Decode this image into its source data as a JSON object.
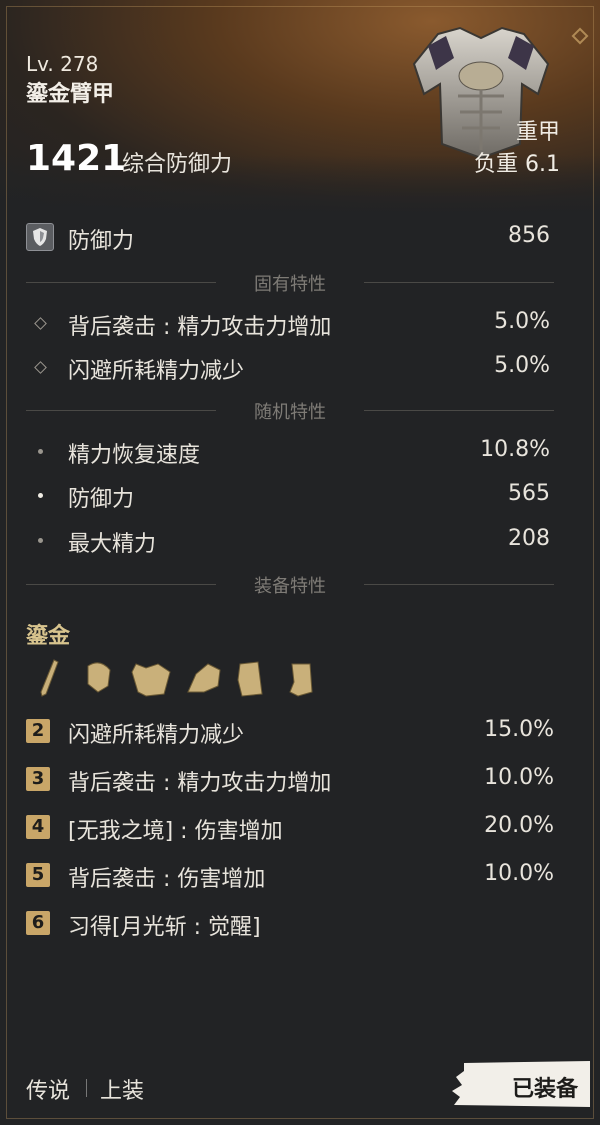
{
  "item": {
    "level": "Lv. 278",
    "name": "鎏金臂甲",
    "score": "1421",
    "score_label": "综合防御力",
    "armor_type": "重甲",
    "weight": "负重 6.1"
  },
  "base_stat": {
    "label": "防御力",
    "value": "856"
  },
  "inherent": {
    "title": "固有特性",
    "items": [
      {
        "label": "背后袭击 : 精力攻击力增加",
        "value": "5.0%"
      },
      {
        "label": "闪避所耗精力减少",
        "value": "5.0%"
      }
    ]
  },
  "random": {
    "title": "随机特性",
    "items": [
      {
        "label": "精力恢复速度",
        "value": "10.8%"
      },
      {
        "label": "防御力",
        "value": "565"
      },
      {
        "label": "最大精力",
        "value": "208"
      }
    ]
  },
  "equip_traits": {
    "title": "装备特性"
  },
  "set": {
    "name": "鎏金",
    "pieces": [
      "sword-icon",
      "helmet-icon",
      "chest-armor-icon",
      "gauntlet-icon",
      "leg-armor-icon",
      "boots-icon"
    ],
    "bonuses": [
      {
        "num": "2",
        "label": "闪避所耗精力减少",
        "value": "15.0%"
      },
      {
        "num": "3",
        "label": "背后袭击 : 精力攻击力增加",
        "value": "10.0%"
      },
      {
        "num": "4",
        "label": "[无我之境] : 伤害增加",
        "value": "20.0%"
      },
      {
        "num": "5",
        "label": "背后袭击 : 伤害增加",
        "value": "10.0%"
      },
      {
        "num": "6",
        "label": "习得[月光斩 : 觉醒]",
        "value": ""
      }
    ]
  },
  "footer": {
    "rarity": "传说",
    "slot": "上装",
    "equipped": "已装备"
  },
  "colors": {
    "gold": "#c9a668",
    "accent_bg": "#5a3a1e"
  }
}
